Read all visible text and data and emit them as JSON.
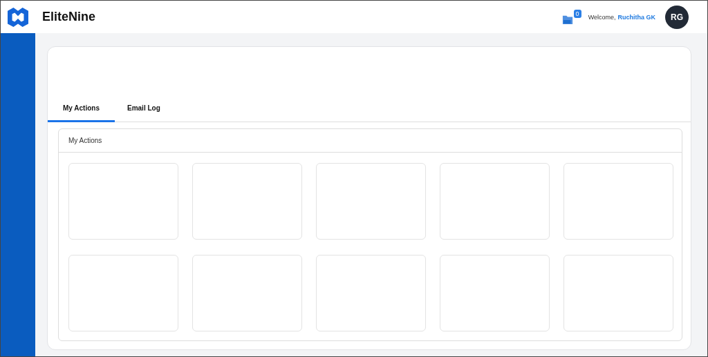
{
  "header": {
    "brand": "EliteNine",
    "sms_count": "0",
    "welcome": "Welcome,",
    "user_name": "Ruchitha GK",
    "avatar_initials": "RG"
  },
  "tabs": [
    {
      "label": "My Actions",
      "selected": true
    },
    {
      "label": "Email Log",
      "selected": false
    }
  ],
  "panel": {
    "title": "My Actions",
    "cards": [
      {
        "kind": "placeholder"
      },
      {
        "kind": "placeholder"
      },
      {
        "kind": "placeholder"
      },
      {
        "kind": "placeholder"
      },
      {
        "kind": "placeholder"
      },
      {
        "kind": "placeholder"
      },
      {
        "kind": "placeholder"
      },
      {
        "kind": "placeholder"
      },
      {
        "kind": "placeholder"
      },
      {
        "kind": "placeholder"
      }
    ]
  }
}
